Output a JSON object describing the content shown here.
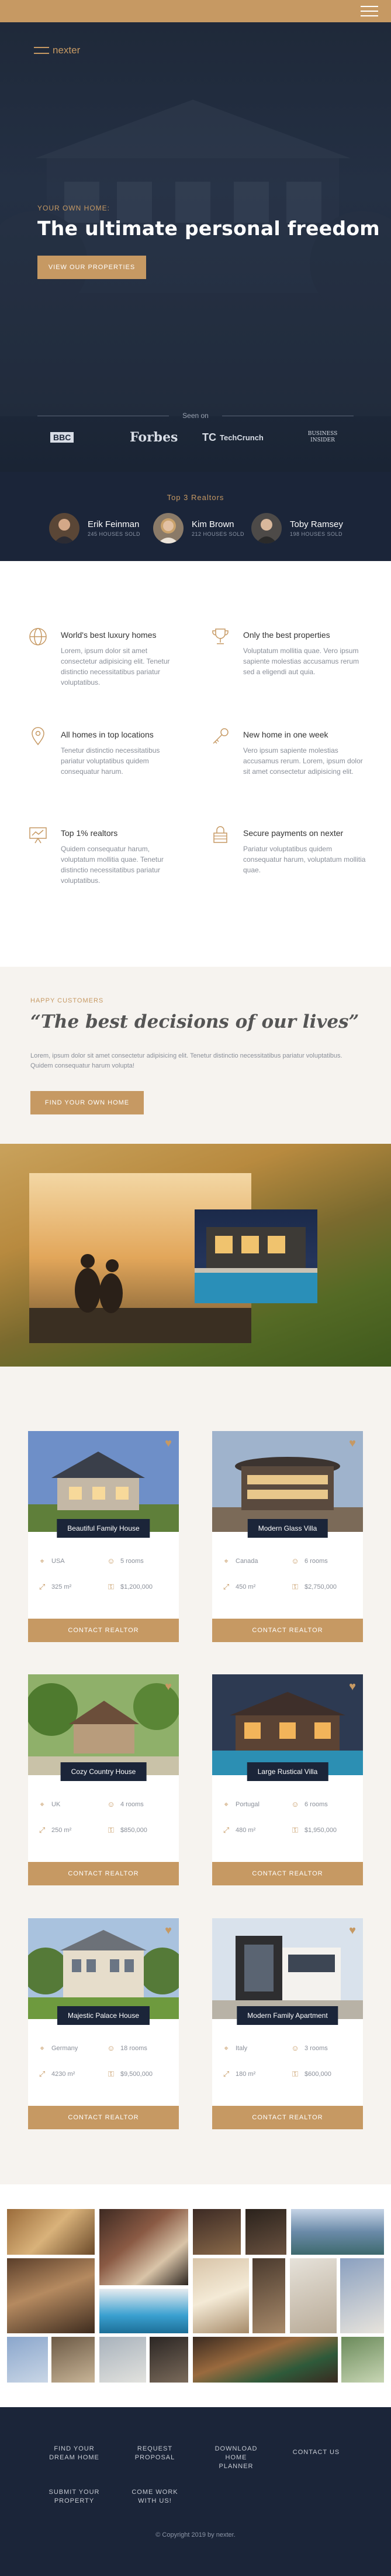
{
  "brand": {
    "name": "nexter"
  },
  "header": {
    "menu_icon": "hamburger-menu-icon"
  },
  "hero": {
    "eyebrow": "Your own home:",
    "title": "The ultimate personal freedom",
    "cta": "View our properties",
    "seen_on": "Seen on",
    "press": [
      "BBC",
      "Forbes",
      "TechCrunch",
      "BUSINESS INSIDER"
    ]
  },
  "realtors": {
    "title": "Top 3 Realtors",
    "items": [
      {
        "name": "Erik Feinman",
        "sold": "245 HOUSES SOLD"
      },
      {
        "name": "Kim Brown",
        "sold": "212 HOUSES SOLD"
      },
      {
        "name": "Toby Ramsey",
        "sold": "198 HOUSES SOLD"
      }
    ]
  },
  "features": [
    {
      "icon": "globe-icon",
      "title": "World's best luxury homes",
      "text": "Lorem, ipsum dolor sit amet consectetur adipisicing elit. Tenetur distinctio necessitatibus pariatur voluptatibus."
    },
    {
      "icon": "trophy-icon",
      "title": "Only the best properties",
      "text": "Voluptatum mollitia quae. Vero ipsum sapiente molestias accusamus rerum sed a eligendi aut quia."
    },
    {
      "icon": "map-pin-icon",
      "title": "All homes in top locations",
      "text": "Tenetur distinctio necessitatibus pariatur voluptatibus quidem consequatur harum."
    },
    {
      "icon": "key-icon",
      "title": "New home in one week",
      "text": "Vero ipsum sapiente molestias accusamus rerum. Lorem, ipsum dolor sit amet consectetur adipisicing elit."
    },
    {
      "icon": "presentation-icon",
      "title": "Top 1% realtors",
      "text": "Quidem consequatur harum, voluptatum mollitia quae. Tenetur distinctio necessitatibus pariatur voluptatibus."
    },
    {
      "icon": "lock-icon",
      "title": "Secure payments on nexter",
      "text": "Pariatur voluptatibus quidem consequatur harum, voluptatum mollitia quae."
    }
  ],
  "story": {
    "eyebrow": "Happy Customers",
    "title": "“The best decisions of our lives”",
    "text": "Lorem, ipsum dolor sit amet consectetur adipisicing elit. Tenetur distinctio necessitatibus pariatur voluptatibus. Quidem consequatur harum volupta!",
    "cta": "Find your own home"
  },
  "homes": {
    "cta": "Contact realtor",
    "items": [
      {
        "name": "Beautiful Family House",
        "location": "USA",
        "rooms": "5 rooms",
        "area": "325 m²",
        "price": "$1,200,000"
      },
      {
        "name": "Modern Glass Villa",
        "location": "Canada",
        "rooms": "6 rooms",
        "area": "450 m²",
        "price": "$2,750,000"
      },
      {
        "name": "Cozy Country House",
        "location": "UK",
        "rooms": "4 rooms",
        "area": "250 m²",
        "price": "$850,000"
      },
      {
        "name": "Large Rustical Villa",
        "location": "Portugal",
        "rooms": "6 rooms",
        "area": "480 m²",
        "price": "$1,950,000"
      },
      {
        "name": "Majestic Palace House",
        "location": "Germany",
        "rooms": "18 rooms",
        "area": "4230 m²",
        "price": "$9,500,000"
      },
      {
        "name": "Modern Family Apartment",
        "location": "Italy",
        "rooms": "3 rooms",
        "area": "180 m²",
        "price": "$600,000"
      }
    ]
  },
  "footer": {
    "links": [
      "Find your dream home",
      "Request proposal",
      "Download home planner",
      "Contact us",
      "Submit your property",
      "Come work with us!"
    ],
    "copyright": "© Copyright 2019 by nexter."
  }
}
